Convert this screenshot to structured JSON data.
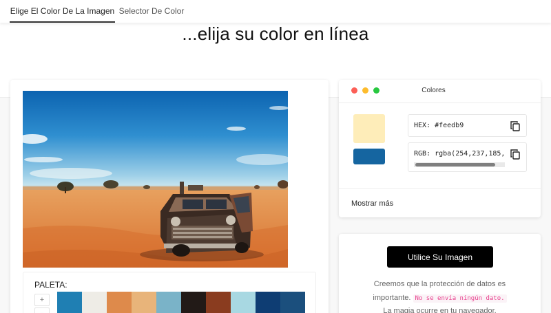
{
  "tabs": [
    {
      "label": "Elige El Color De La Imagen",
      "active": true
    },
    {
      "label": "Selector De Color",
      "active": false
    }
  ],
  "headline": "...elija su color en línea",
  "palette": {
    "title": "PALETA:",
    "zoom_in": "+",
    "zoom_out": "−",
    "colors": [
      "#1f7fb3",
      "#eeece6",
      "#de8a4b",
      "#e8b47a",
      "#7ab3c8",
      "#221a17",
      "#8a3c1f",
      "#a8d8e2",
      "#0e3d73",
      "#1b4f7d"
    ]
  },
  "colors_panel": {
    "title": "Colores",
    "hex_value": "HEX: #feedb9",
    "rgb_value": "RGB: rgba(254,237,185,",
    "selected_color": "#feedb9",
    "secondary_color": "#1565a0",
    "show_more": "Mostrar más"
  },
  "use_image": {
    "button_label": "Utilice Su Imagen",
    "privacy_line1": "Creemos que la protección de datos es",
    "privacy_line2_prefix": "importante.",
    "privacy_code": "No se envía ningún dato.",
    "privacy_line3": "La magia ocurre en tu navegador."
  },
  "image": {
    "description_icon": "desert-car-photo"
  }
}
